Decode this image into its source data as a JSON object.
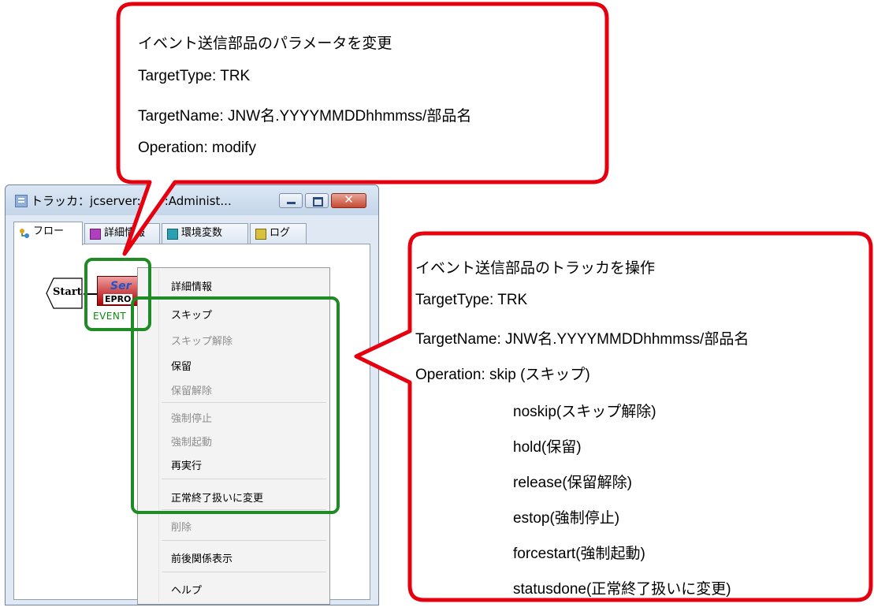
{
  "window": {
    "title": "トラッカ：jcserver:ﾕﾆｯﾄ:Administ...",
    "tabs": [
      {
        "label": "フロー",
        "active": true
      },
      {
        "label": "詳細情報",
        "active": false
      },
      {
        "label": "環境変数",
        "active": false
      },
      {
        "label": "ログ",
        "active": false
      }
    ]
  },
  "flow": {
    "start_label": "Start",
    "event_icon_text": "EPRO",
    "event_icon_script": "Ser",
    "event_caption": "EVENT"
  },
  "context_menu": {
    "items": [
      {
        "label": "詳細情報",
        "enabled": true
      },
      {
        "label": "スキップ",
        "enabled": true
      },
      {
        "label": "スキップ解除",
        "enabled": false
      },
      {
        "label": "保留",
        "enabled": true
      },
      {
        "label": "保留解除",
        "enabled": false
      },
      {
        "label": "強制停止",
        "enabled": false
      },
      {
        "label": "強制起動",
        "enabled": false
      },
      {
        "label": "再実行",
        "enabled": true
      },
      {
        "label": "正常終了扱いに変更",
        "enabled": true
      },
      {
        "label": "削除",
        "enabled": false
      },
      {
        "label": "前後関係表示",
        "enabled": true
      },
      {
        "label": "ヘルプ",
        "enabled": true
      }
    ]
  },
  "callout_top": {
    "lines": [
      "イベント送信部品のパラメータを変更",
      "TargetType: TRK",
      "TargetName: JNW名.YYYYMMDDhhmmss/部品名",
      "Operation: modify"
    ]
  },
  "callout_right": {
    "lines": [
      "イベント送信部品のトラッカを操作",
      "TargetType: TRK",
      "TargetName: JNW名.YYYYMMDDhhmmss/部品名",
      "Operation: skip (スキップ)",
      "noskip(スキップ解除)",
      "hold(保留)",
      "release(保留解除)",
      "estop(強制停止)",
      "forcestart(強制起動)",
      "statusdone(正常終了扱いに変更)"
    ]
  },
  "colors": {
    "callout_border": "#e6000f",
    "highlight_border": "#1f8b25",
    "window_frame": "#dfe8f3"
  }
}
